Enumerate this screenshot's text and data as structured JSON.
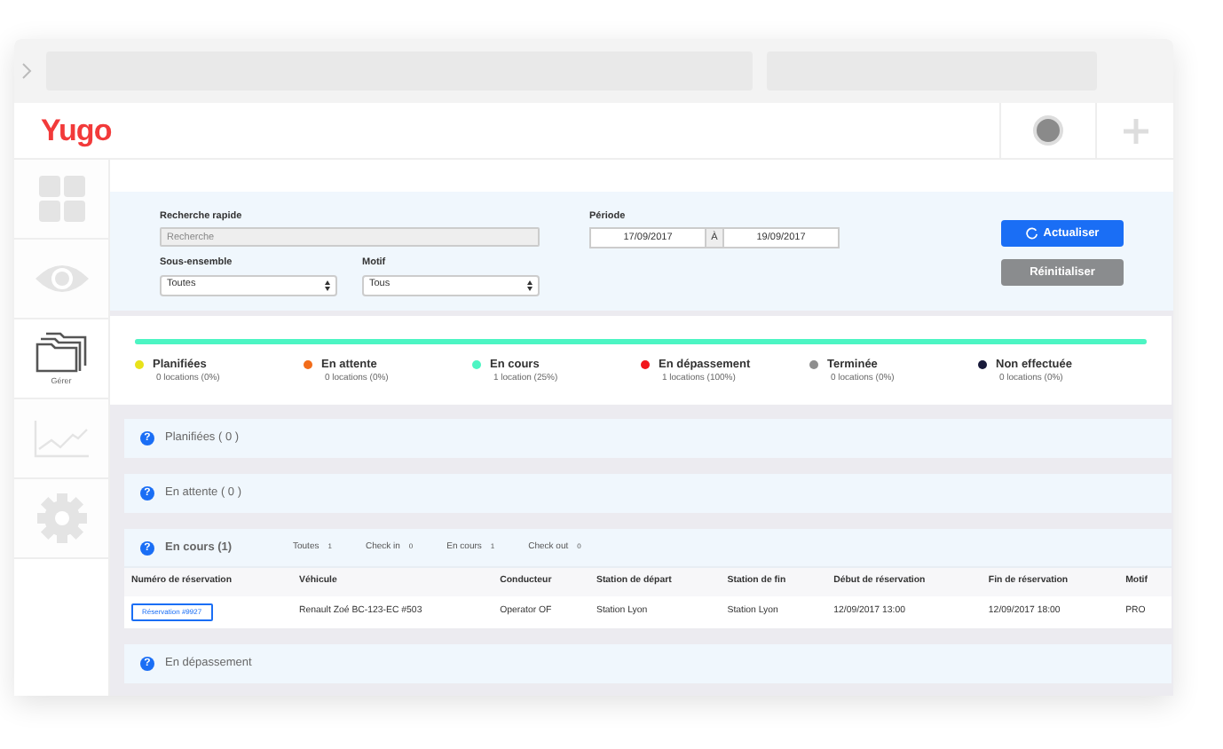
{
  "header": {
    "logo": "Yugo"
  },
  "sidebar": {
    "items": [
      {
        "kind": "grid",
        "selected": false
      },
      {
        "kind": "eye",
        "selected": false
      },
      {
        "kind": "folders",
        "label": "Gérer",
        "selected": true
      },
      {
        "kind": "chart",
        "selected": false
      },
      {
        "kind": "gear",
        "selected": false
      }
    ]
  },
  "filters": {
    "search_label": "Recherche rapide",
    "search_placeholder": "Recherche",
    "period_label": "Période",
    "date_from": "17/09/2017",
    "date_sep": "À",
    "date_to": "19/09/2017",
    "subset_label": "Sous-ensemble",
    "subset_value": "Toutes",
    "reason_label": "Motif",
    "reason_value": "Tous",
    "refresh_button": "Actualiser",
    "reset_button": "Réinitialiser"
  },
  "progress": {
    "level": 1
  },
  "legend": [
    {
      "label": "Planifiées",
      "count": "0 locations (0%)",
      "color": "#e8e21a"
    },
    {
      "label": "En attente",
      "count": "0 locations (0%)",
      "color": "#f26c1a"
    },
    {
      "label": "En cours",
      "count": "1 location (25%)",
      "color": "#4cf5c3"
    },
    {
      "label": "En dépassement",
      "count": "1 locations (100%)",
      "color": "#f2161b"
    },
    {
      "label": "Terminée",
      "count": "0 locations (0%)",
      "color": "#8e8e8e"
    },
    {
      "label": "Non effectuée",
      "count": "0 locations (0%)",
      "color": "#181a3a"
    }
  ],
  "sections": [
    {
      "icon": "?",
      "title": "Planifiées ( 0 )",
      "expanded": false
    },
    {
      "icon": "?",
      "title": "En attente ( 0 )",
      "expanded": false
    },
    {
      "icon": "?",
      "title": "En cours (1)",
      "expanded": true,
      "chips": [
        {
          "label": "Toutes",
          "count": "1"
        },
        {
          "label": "Check in",
          "count": "0"
        },
        {
          "label": "En cours",
          "count": "1"
        },
        {
          "label": "Check out",
          "count": "0"
        }
      ],
      "table": {
        "columns": [
          "Numéro de réservation",
          "Véhicule",
          "Conducteur",
          "Station de départ",
          "Station de fin",
          "Début de réservation",
          "Fin de réservation",
          "Motif"
        ],
        "rows": [
          [
            "Réservation #9927",
            "Renault Zoé BC-123-EC #503",
            "Operator OF",
            "Station Lyon",
            "Station Lyon",
            "12/09/2017 13:00",
            "12/09/2017 18:00",
            "PRO"
          ]
        ]
      }
    },
    {
      "icon": "?",
      "title": "En dépassement",
      "expanded": false
    }
  ]
}
